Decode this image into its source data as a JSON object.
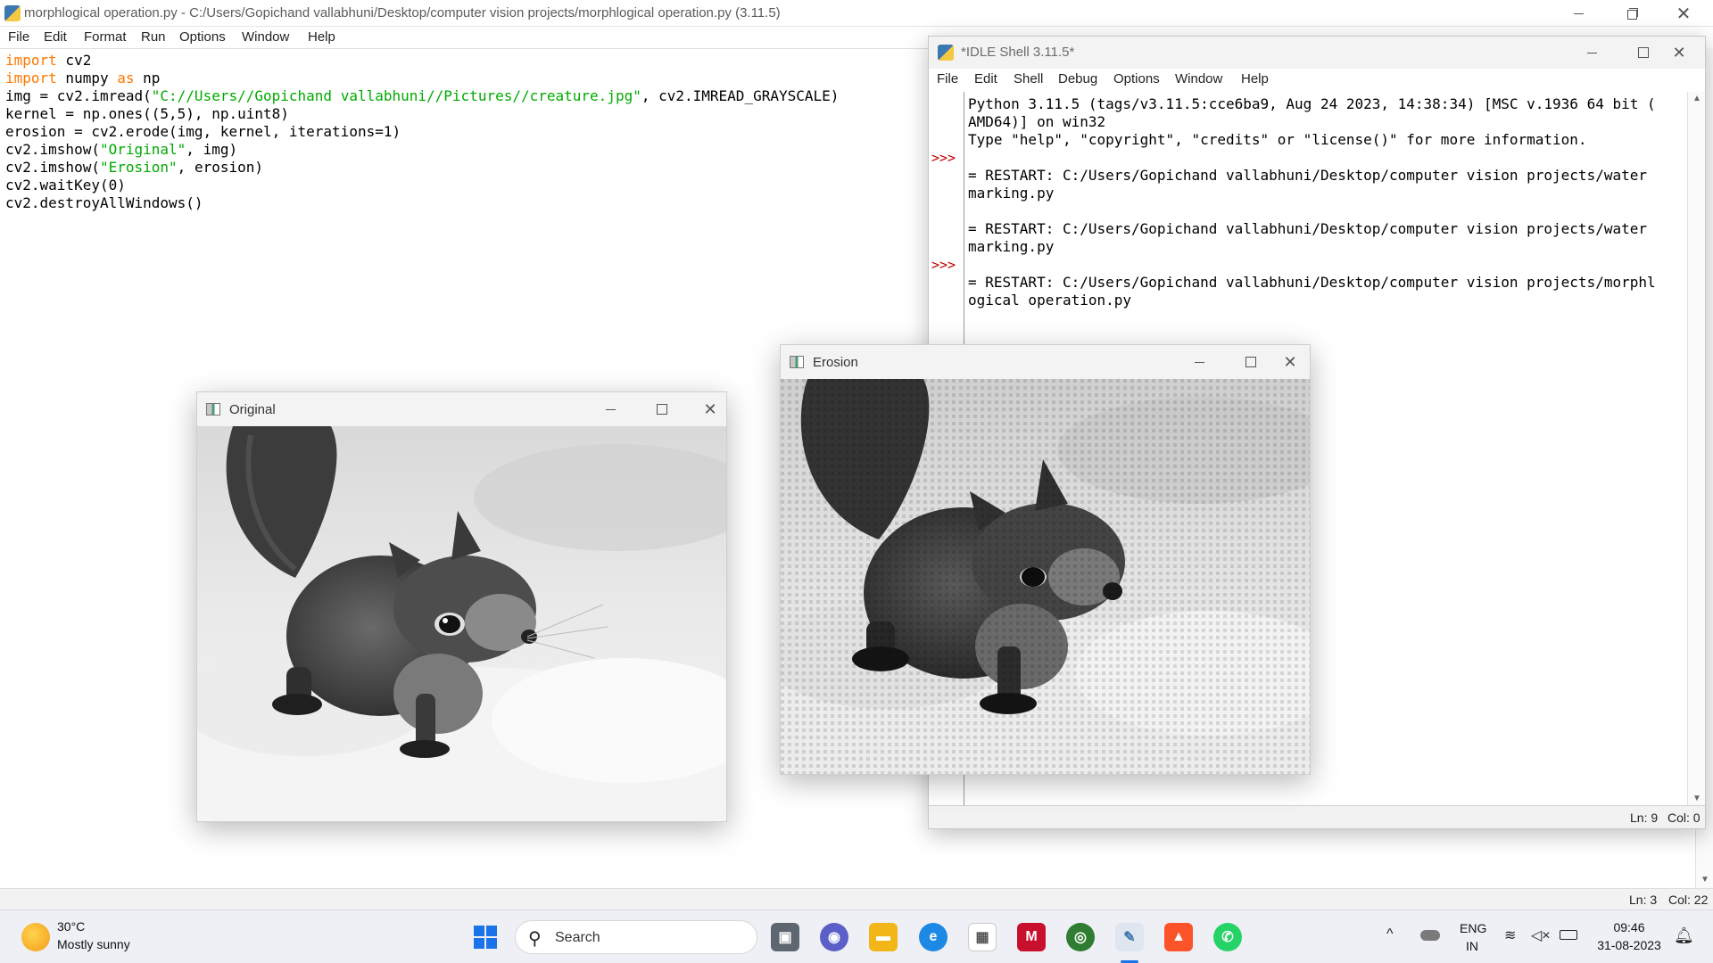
{
  "editor": {
    "title": "morphlogical operation.py - C:/Users/Gopichand vallabhuni/Desktop/computer vision projects/morphlogical operation.py (3.11.5)",
    "menu": [
      "File",
      "Edit",
      "Format",
      "Run",
      "Options",
      "Window",
      "Help"
    ],
    "code": [
      [
        {
          "t": "import",
          "c": "kw"
        },
        {
          "t": " cv2",
          "c": ""
        }
      ],
      [
        {
          "t": "import",
          "c": "kw"
        },
        {
          "t": " numpy ",
          "c": ""
        },
        {
          "t": "as",
          "c": "kw"
        },
        {
          "t": " np",
          "c": ""
        }
      ],
      [
        {
          "t": "img = cv2.imread(",
          "c": ""
        },
        {
          "t": "\"C://Users//Gopichand vallabhuni//Pictures//creature.jpg\"",
          "c": "str"
        },
        {
          "t": ", cv2.IMREAD_GRAYSCALE)",
          "c": ""
        }
      ],
      [
        {
          "t": "kernel = np.ones((5,5), np.uint8)",
          "c": ""
        }
      ],
      [
        {
          "t": "erosion = cv2.erode(img, kernel, iterations=1)",
          "c": ""
        }
      ],
      [
        {
          "t": "cv2.imshow(",
          "c": ""
        },
        {
          "t": "\"Original\"",
          "c": "str"
        },
        {
          "t": ", img)",
          "c": ""
        }
      ],
      [
        {
          "t": "cv2.imshow(",
          "c": ""
        },
        {
          "t": "\"Erosion\"",
          "c": "str"
        },
        {
          "t": ", erosion)",
          "c": ""
        }
      ],
      [
        {
          "t": "cv2.waitKey(0)",
          "c": ""
        }
      ],
      [
        {
          "t": "cv2.destroyAllWindows()",
          "c": ""
        }
      ]
    ],
    "status_ln": "Ln: 3",
    "status_col": "Col: 22"
  },
  "shell": {
    "title": "*IDLE Shell 3.11.5*",
    "menu": [
      "File",
      "Edit",
      "Shell",
      "Debug",
      "Options",
      "Window",
      "Help"
    ],
    "lines": [
      "Python 3.11.5 (tags/v3.11.5:cce6ba9, Aug 24 2023, 14:38:34) [MSC v.1936 64 bit (",
      "AMD64)] on win32",
      "Type \"help\", \"copyright\", \"credits\" or \"license()\" for more information.",
      "",
      "= RESTART: C:/Users/Gopichand vallabhuni/Desktop/computer vision projects/water",
      "marking.py",
      "",
      "= RESTART: C:/Users/Gopichand vallabhuni/Desktop/computer vision projects/water",
      "marking.py",
      "",
      "= RESTART: C:/Users/Gopichand vallabhuni/Desktop/computer vision projects/morphl",
      "ogical operation.py"
    ],
    "prompts": [
      ">>>",
      ">>>"
    ],
    "status_ln": "Ln: 9",
    "status_col": "Col: 0"
  },
  "original_window": {
    "title": "Original"
  },
  "erosion_window": {
    "title": "Erosion"
  },
  "taskbar": {
    "weather_temp": "30°C",
    "weather_desc": "Mostly sunny",
    "search_placeholder": "Search",
    "lang_top": "ENG",
    "lang_bottom": "IN",
    "time": "09:46",
    "date": "31-08-2023"
  }
}
